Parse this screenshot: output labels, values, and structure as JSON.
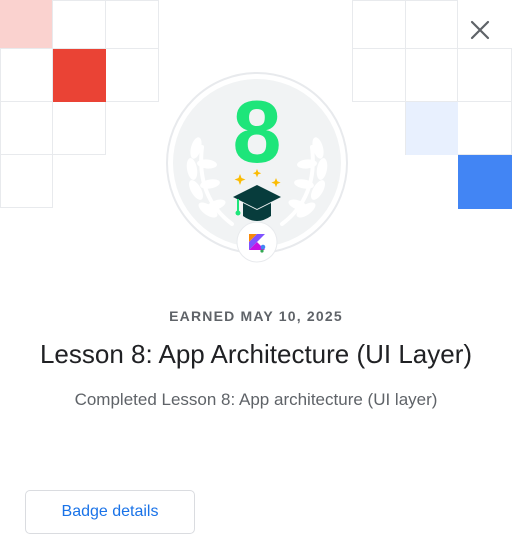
{
  "badge": {
    "number": "8",
    "earned_text": "EARNED MAY 10, 2025",
    "title": "Lesson 8: App Architecture (UI Layer)",
    "description": "Completed Lesson 8: App architecture (UI layer)",
    "laurel_icon": "laurel-wreath-icon",
    "cap_icon": "graduation-cap-icon",
    "language_icon": "kotlin-logo-icon"
  },
  "actions": {
    "close_icon": "close-icon",
    "details_label": "Badge details"
  },
  "colors": {
    "number_green": "#1ee57a",
    "grid_red": "#ea4335",
    "grid_light_red": "#fad2cf",
    "grid_blue": "#4285f4",
    "grid_light_blue": "#e8f0fe",
    "link_blue": "#1a73e8"
  }
}
